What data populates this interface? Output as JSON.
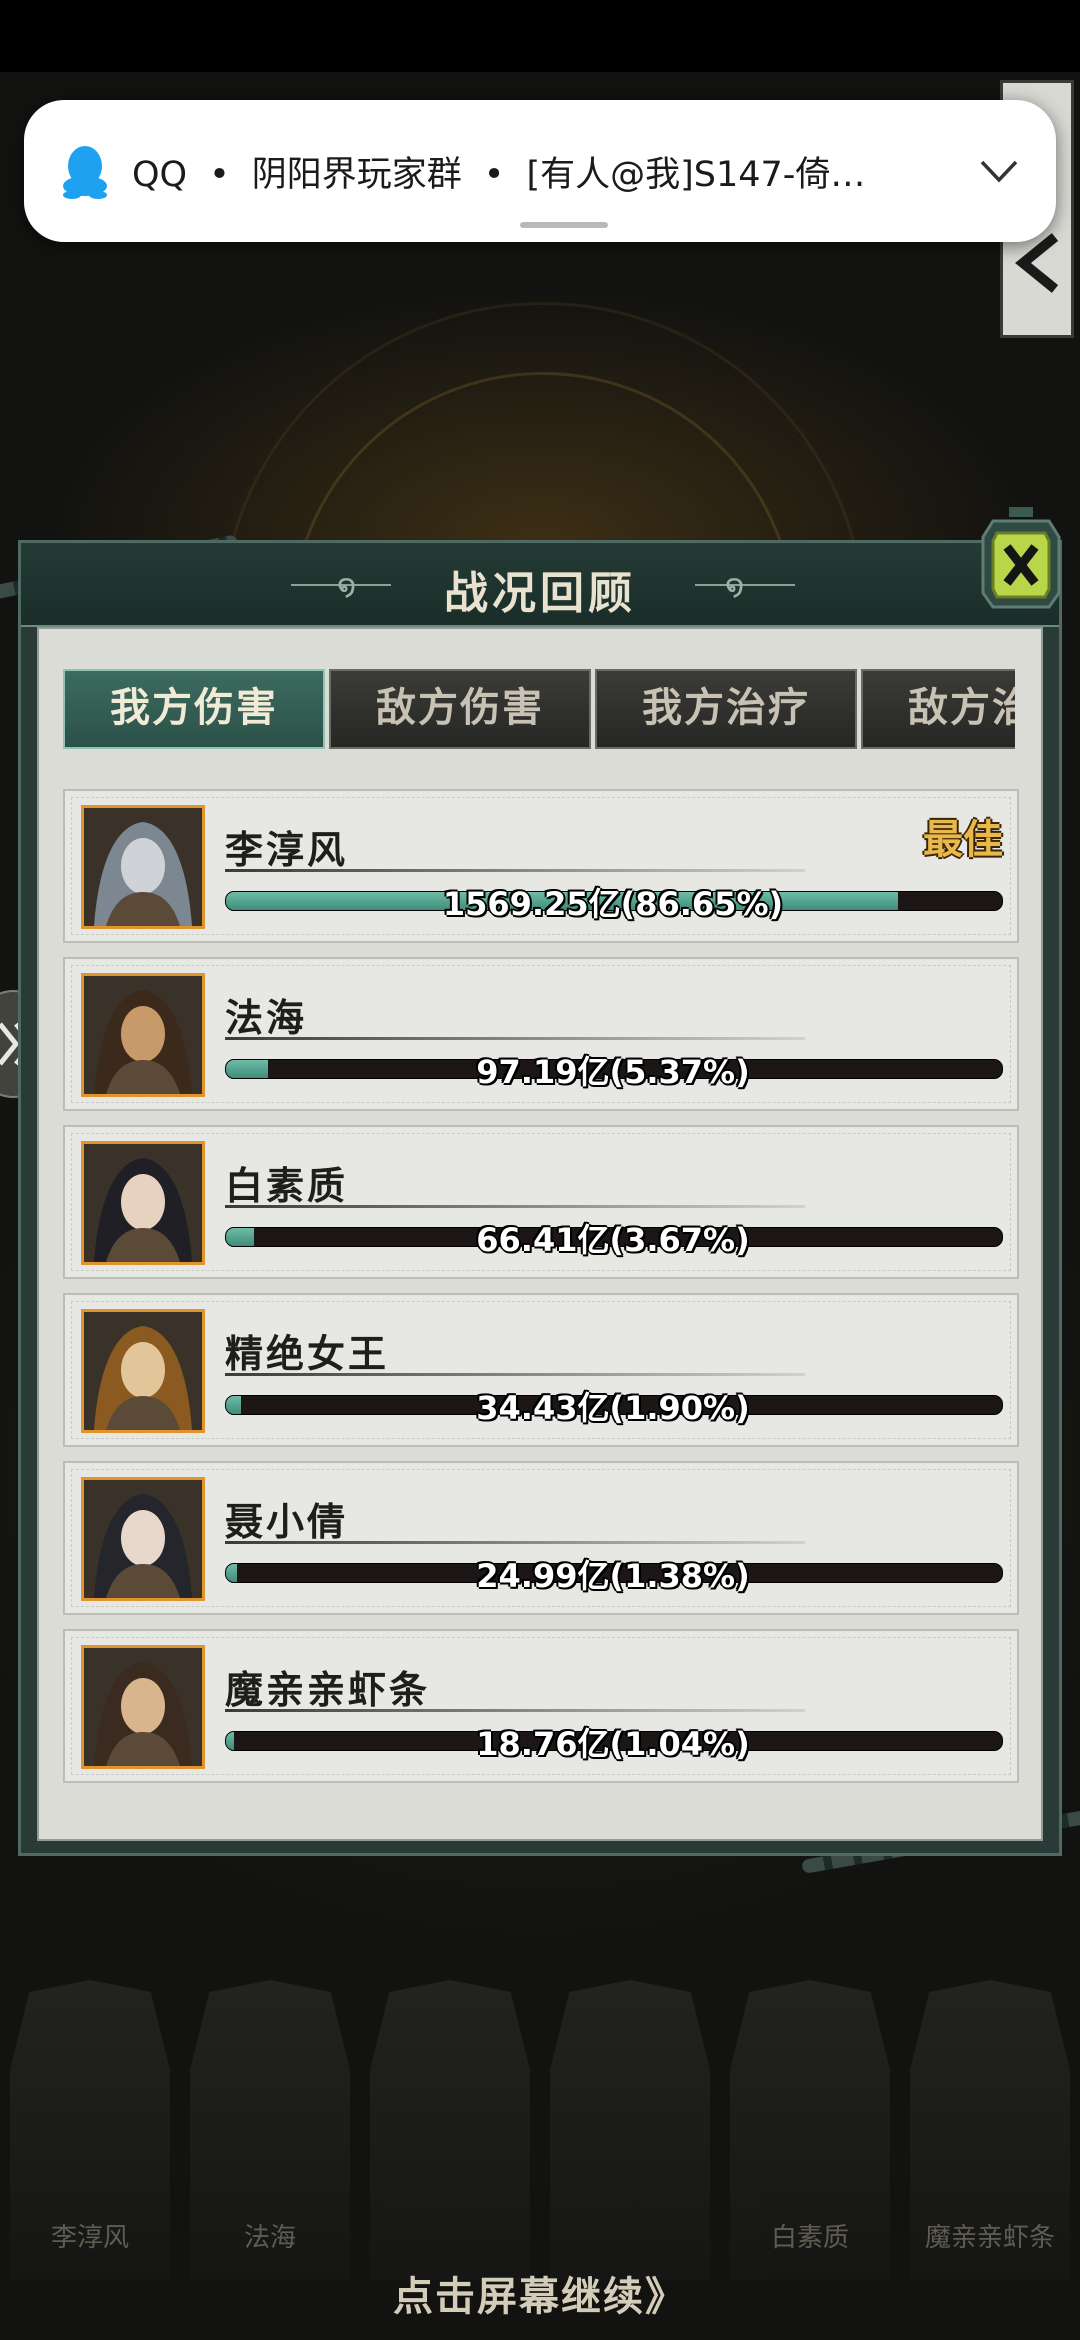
{
  "notification": {
    "app": "QQ",
    "group": "阴阳界玩家群",
    "message": "[有人@我]S147-倚…",
    "icons": [
      "qq-penguin-icon",
      "chevron-down-icon"
    ]
  },
  "panel": {
    "title": "战况回顾",
    "tabs": [
      {
        "label": "我方伤害",
        "active": true
      },
      {
        "label": "敌方伤害",
        "active": false
      },
      {
        "label": "我方治疗",
        "active": false
      },
      {
        "label": "敌方治疗",
        "active": false
      }
    ],
    "best_label": "最佳",
    "rows": [
      {
        "name": "李淳风",
        "value_text": "1569.25亿(86.65%)",
        "percent": 86.65
      },
      {
        "name": "法海",
        "value_text": "97.19亿(5.37%)",
        "percent": 5.37
      },
      {
        "name": "白素质",
        "value_text": "66.41亿(3.67%)",
        "percent": 3.67
      },
      {
        "name": "精绝女王",
        "value_text": "34.43亿(1.90%)",
        "percent": 1.9
      },
      {
        "name": "聂小倩",
        "value_text": "24.99亿(1.38%)",
        "percent": 1.38
      },
      {
        "name": "魔亲亲虾条",
        "value_text": "18.76亿(1.04%)",
        "percent": 1.04
      }
    ]
  },
  "bottom_cards": [
    {
      "name": "李淳风"
    },
    {
      "name": "法海"
    },
    {
      "name": ""
    },
    {
      "name": ""
    },
    {
      "name": "白素质"
    },
    {
      "name": "魔亲亲虾条"
    }
  ],
  "continue_text": "点击屏幕继续》",
  "colors": {
    "accent": "#4fa58f",
    "best": "#e9b84a",
    "avatar_border": "#e0942d"
  }
}
